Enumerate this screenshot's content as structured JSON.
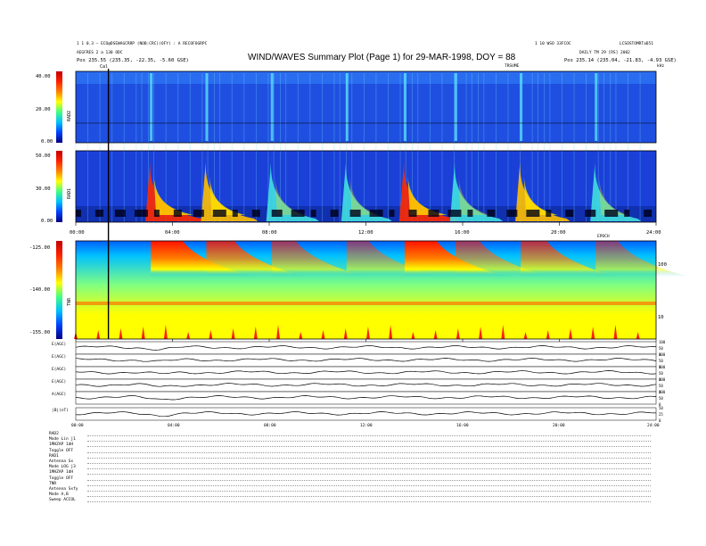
{
  "header": {
    "left_line1": "1 1 0.3 – ECO@DSEWAGCRRP (NOB:CRC)(OFY) : A RECOFOGRPC",
    "left_line2": "AEGFRES 2 a 130 ODC",
    "left_line3": "Pos    235.55 (235.35, -22.35, -5.60 GSE)",
    "right_line1": "1 10 WSO 33FCOC",
    "right_line2": "LCSOSTOMRTaD51",
    "right_line3": "DAILY TM 29 [RS] 2002",
    "right_line4": "Pos    235.14 (235.04, -21.83, -4.93 GSE)",
    "title": "WIND/WAVES Summary Plot (Page 1) for 29-MAR-1998, DOY = 88",
    "marker_label": "Cal",
    "top_right_unit": "TRSUME",
    "top_right_small": "kHz"
  },
  "chart_data": {
    "type": "heatmap",
    "title": "WIND/WAVES Summary Plot (Page 1) for 29-MAR-1998, DOY = 88",
    "xlim": [
      0,
      24
    ],
    "x_tick_labels": [
      "00:00",
      "04:00",
      "08:00",
      "12:00",
      "16:00",
      "20:00",
      "24:00"
    ],
    "x_axis_unit": "EPOCH",
    "cal_marker_hour": 1.35,
    "panels": [
      {
        "name": "RAD2",
        "ylim": [
          0,
          40
        ],
        "y_tick_labels": [
          "40.00",
          "20.00",
          "0.00"
        ]
      },
      {
        "name": "RAD1",
        "ylim": [
          0,
          50
        ],
        "y_tick_labels": [
          "50.00",
          "30.00",
          "0.00"
        ]
      },
      {
        "name": "TNR",
        "ylim": [
          -155,
          -125
        ],
        "y_tick_labels": [
          "-125.00",
          "-140.00",
          "-155.00"
        ],
        "right_tick_labels": [
          "100",
          "10"
        ]
      }
    ],
    "colorbar": {
      "colors": [
        "#c00000",
        "#ff2000",
        "#ff8000",
        "#ffff00",
        "#40ff80",
        "#00c0ff",
        "#0040ff",
        "#000080"
      ]
    },
    "bursts": [
      {
        "hour": 3.1,
        "intensity": 1.0
      },
      {
        "hour": 5.4,
        "intensity": 0.8
      },
      {
        "hour": 8.1,
        "intensity": 0.6
      },
      {
        "hour": 11.2,
        "intensity": 0.5
      },
      {
        "hour": 13.6,
        "intensity": 1.0
      },
      {
        "hour": 15.7,
        "intensity": 0.6
      },
      {
        "hour": 18.4,
        "intensity": 0.7
      },
      {
        "hour": 21.5,
        "intensity": 0.5
      }
    ],
    "line_panels": [
      {
        "label": "E(AGC)",
        "right_ticks": [
          "100",
          "50",
          "0"
        ]
      },
      {
        "label": "E(AGC)",
        "right_ticks": [
          "100",
          "50",
          "0"
        ]
      },
      {
        "label": "E(AGC)",
        "right_ticks": [
          "100",
          "50",
          "0"
        ]
      },
      {
        "label": "E(AGC)",
        "right_ticks": [
          "100",
          "50",
          "0"
        ]
      },
      {
        "label": "A(AGC)",
        "right_ticks": [
          "100",
          "50",
          "0"
        ]
      },
      {
        "label": "|B|(nT)",
        "right_ticks": [
          "50",
          "25",
          "0"
        ]
      }
    ],
    "bottom_x_tick_labels": [
      "00:00",
      "04:00",
      "08:00",
      "12:00",
      "16:00",
      "20:00",
      "24:00"
    ]
  },
  "params": {
    "rows": [
      "RAD2",
      "Mode    Lin j1",
      "1MHZAP 1dH",
      "Toggle    OFF",
      "RAD1",
      "Antenna    Sx",
      "Mode    LOG j3",
      "1MHZAP 1dH",
      "Toggle    OFF",
      "TNR",
      "Antenna    Sxfy",
      "Mode    A,B",
      "Sweep    ACCOL"
    ]
  }
}
